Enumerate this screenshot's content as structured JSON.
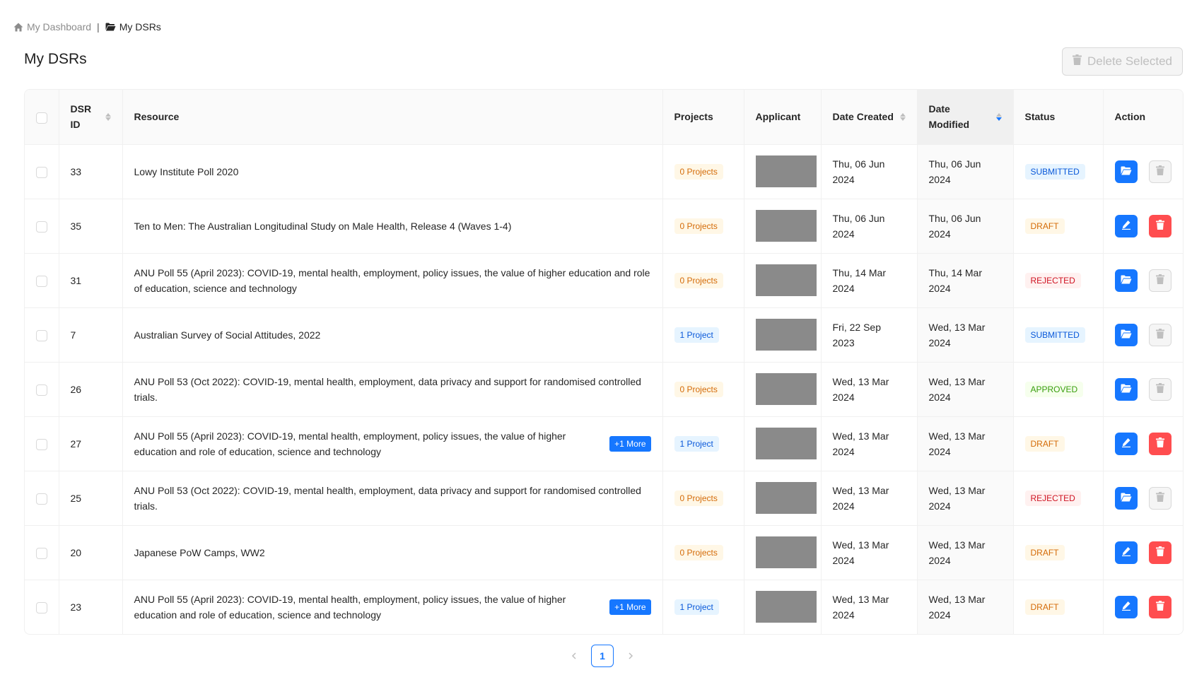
{
  "breadcrumb": {
    "home_label": "My Dashboard",
    "separator": "|",
    "current_label": "My DSRs"
  },
  "page_title": "My DSRs",
  "delete_selected_label": "Delete Selected",
  "table": {
    "columns": {
      "dsr_id": "DSR ID",
      "resource": "Resource",
      "projects": "Projects",
      "applicant": "Applicant",
      "date_created": "Date Created",
      "date_modified": "Date Modified",
      "status": "Status",
      "action": "Action"
    },
    "sorted_column": "date_modified",
    "rows": [
      {
        "id": "33",
        "resource": "Lowy Institute Poll 2020",
        "more": "",
        "projects": "0 Projects",
        "created": "Thu, 06 Jun 2024",
        "modified": "Thu, 06 Jun 2024",
        "status": "SUBMITTED",
        "editable": false
      },
      {
        "id": "35",
        "resource": "Ten to Men: The Australian Longitudinal Study on Male Health, Release 4 (Waves 1-4)",
        "more": "",
        "projects": "0 Projects",
        "created": "Thu, 06 Jun 2024",
        "modified": "Thu, 06 Jun 2024",
        "status": "DRAFT",
        "editable": true
      },
      {
        "id": "31",
        "resource": "ANU Poll 55 (April 2023): COVID-19, mental health, employment, policy issues, the value of higher education and role of education, science and technology",
        "more": "",
        "projects": "0 Projects",
        "created": "Thu, 14 Mar 2024",
        "modified": "Thu, 14 Mar 2024",
        "status": "REJECTED",
        "editable": false
      },
      {
        "id": "7",
        "resource": "Australian Survey of Social Attitudes, 2022",
        "more": "",
        "projects": "1 Project",
        "created": "Fri, 22 Sep 2023",
        "modified": "Wed, 13 Mar 2024",
        "status": "SUBMITTED",
        "editable": false
      },
      {
        "id": "26",
        "resource": "ANU Poll 53 (Oct 2022): COVID-19, mental health, employment, data privacy and support for randomised controlled trials.",
        "more": "",
        "projects": "0 Projects",
        "created": "Wed, 13 Mar 2024",
        "modified": "Wed, 13 Mar 2024",
        "status": "APPROVED",
        "editable": false
      },
      {
        "id": "27",
        "resource": "ANU Poll 55 (April 2023): COVID-19, mental health, employment, policy issues, the value of higher education and role of education, science and technology",
        "more": "+1 More",
        "projects": "1 Project",
        "created": "Wed, 13 Mar 2024",
        "modified": "Wed, 13 Mar 2024",
        "status": "DRAFT",
        "editable": true
      },
      {
        "id": "25",
        "resource": "ANU Poll 53 (Oct 2022): COVID-19, mental health, employment, data privacy and support for randomised controlled trials.",
        "more": "",
        "projects": "0 Projects",
        "created": "Wed, 13 Mar 2024",
        "modified": "Wed, 13 Mar 2024",
        "status": "REJECTED",
        "editable": false
      },
      {
        "id": "20",
        "resource": "Japanese PoW Camps, WW2",
        "more": "",
        "projects": "0 Projects",
        "created": "Wed, 13 Mar 2024",
        "modified": "Wed, 13 Mar 2024",
        "status": "DRAFT",
        "editable": true
      },
      {
        "id": "23",
        "resource": "ANU Poll 55 (April 2023): COVID-19, mental health, employment, policy issues, the value of higher education and role of education, science and technology",
        "more": "+1 More",
        "projects": "1 Project",
        "created": "Wed, 13 Mar 2024",
        "modified": "Wed, 13 Mar 2024",
        "status": "DRAFT",
        "editable": true
      }
    ]
  },
  "pagination": {
    "current_page": "1",
    "prev_icon": "chevron-left-icon",
    "next_icon": "chevron-right-icon"
  },
  "colors": {
    "primary": "#1677ff",
    "danger": "#ff4d4f",
    "applicant_redaction": "#8a8a8a"
  }
}
